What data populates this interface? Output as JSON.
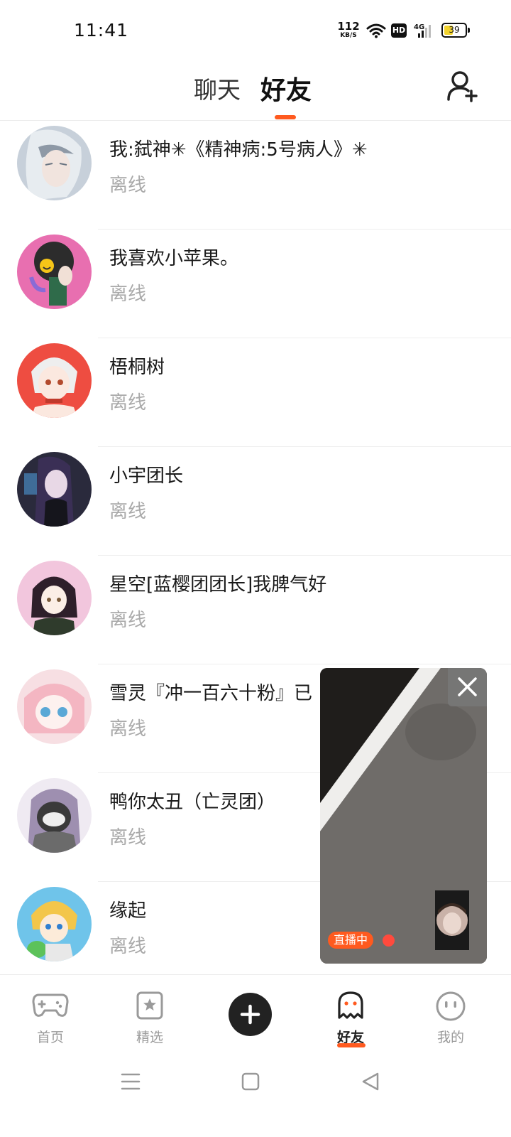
{
  "status_bar": {
    "time": "11:41",
    "net_speed_value": "112",
    "net_speed_unit": "KB/S",
    "hd_label": "HD",
    "network_type": "4G",
    "battery_level": "39"
  },
  "header": {
    "tab_chat": "聊天",
    "tab_friends": "好友",
    "active_tab": "好友"
  },
  "friends": [
    {
      "name": "我:弑神✳《精神病:5号病人》✳",
      "status": "离线"
    },
    {
      "name": "我喜欢小苹果。",
      "status": "离线"
    },
    {
      "name": "梧桐树",
      "status": "离线"
    },
    {
      "name": "小宇团长",
      "status": "离线"
    },
    {
      "name": "星空[蓝樱团团长]我脾气好",
      "status": "离线"
    },
    {
      "name": "雪灵『冲一百六十粉』已",
      "status": "离线"
    },
    {
      "name": "鸭你太丑（亡灵团）",
      "status": "离线"
    },
    {
      "name": "缘起",
      "status": "离线"
    }
  ],
  "live_window": {
    "badge": "直播中"
  },
  "bottom_nav": {
    "items": [
      {
        "label": "首页",
        "icon": "gamepad-icon"
      },
      {
        "label": "精选",
        "icon": "star-bookmark-icon"
      },
      {
        "label": "",
        "icon": "plus-icon"
      },
      {
        "label": "好友",
        "icon": "ghost-icon"
      },
      {
        "label": "我的",
        "icon": "face-icon"
      }
    ],
    "active": "好友"
  },
  "colors": {
    "accent": "#ff5a1f",
    "offline_text": "#a9a9a9",
    "live_dot": "#ff4a3d"
  }
}
